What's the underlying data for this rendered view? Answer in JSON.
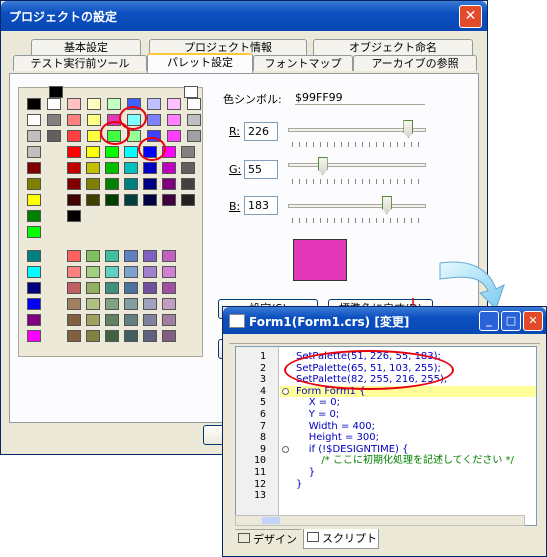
{
  "dialog": {
    "title": "プロジェクトの設定",
    "tabs_row1": [
      "基本設定",
      "プロジェクト情報",
      "オブジェクト命名"
    ],
    "tabs_row2": [
      "テスト実行前ツール",
      "パレット設定",
      "フォントマップ",
      "アーカイブの参照"
    ],
    "selected_tab": "パレット設定",
    "color_symbol_label": "色シンボル:",
    "color_symbol_value": "$99FF99",
    "r_label": "R:",
    "r_value": "226",
    "r_level": 0.886,
    "g_label": "G:",
    "g_value": "55",
    "g_level": 0.216,
    "b_label": "B:",
    "b_value": "183",
    "b_level": 0.718,
    "preview_color": "#e237b7",
    "btn_set": "設定(S)",
    "btn_default": "標準色に戻す(D)"
  },
  "palette": {
    "colors": [
      [
        "#000000",
        "#ffffff",
        "#ffc0c0",
        "#ffffc0",
        "#c0ffc0",
        "#4060ff",
        "#c0c0ff",
        "#ffc0ff",
        "#ffffff"
      ],
      [
        "#ffffff",
        "#808080",
        "#ff8080",
        "#ffff80",
        "#e237b7",
        "#80ffff",
        "#8080ff",
        "#ff80ff",
        "#c0c0c0"
      ],
      [
        "#c0c0c0",
        "#606060",
        "#ff4040",
        "#ffff40",
        "#40ff40",
        "#99ff99",
        "#4040ff",
        "#ff40ff",
        "#a0a0a0"
      ],
      [
        "#c0c0c0",
        "#ff0000",
        "#ffff00",
        "#00ff00",
        "#00ffff",
        "#0000ff",
        "#ff00ff",
        "#808080"
      ],
      [
        "#800000",
        "#c00000",
        "#c0c000",
        "#00c000",
        "#00c0c0",
        "#0000c0",
        "#c000c0",
        "#606060"
      ],
      [
        "#808000",
        "#800000",
        "#808000",
        "#008000",
        "#008080",
        "#000080",
        "#800080",
        "#404040"
      ],
      [
        "#ffff00",
        "#400000",
        "#404000",
        "#004000",
        "#004040",
        "#000040",
        "#400040",
        "#202020"
      ],
      [
        "#008000",
        "#000000"
      ],
      [
        "#00ff00"
      ],
      [
        "#008080",
        "#ff6060",
        "#80c060",
        "#40c0a0",
        "#6080c0",
        "#8060c0",
        "#c060c0"
      ],
      [
        "#00ffff",
        "#ff8080",
        "#a0d080",
        "#60d0c0",
        "#80a0d0",
        "#a080d0",
        "#d080d0"
      ],
      [
        "#000080",
        "#c06060",
        "#90b060",
        "#409080",
        "#5070a0",
        "#7050a0",
        "#a050a0"
      ],
      [
        "#0000ff",
        "#a08060",
        "#b0c080",
        "#80a080",
        "#80a0a0",
        "#a0a0c0",
        "#c0a0c0"
      ],
      [
        "#800080",
        "#806040",
        "#a0a060",
        "#608060",
        "#608080",
        "#8080a0",
        "#a080a0"
      ],
      [
        "#ff00ff",
        "#806040",
        "#808040",
        "#406040",
        "#406060",
        "#606080",
        "#806080"
      ]
    ]
  },
  "editor": {
    "title": "Form1(Form1.crs) [変更]",
    "line_numbers": [
      "1",
      "2",
      "3",
      "4",
      "5",
      "6",
      "7",
      "8",
      "9",
      "10",
      "11",
      "12",
      "13"
    ],
    "lines": [
      "SetPalette(51, 226, 55, 183);",
      "SetPalette(65, 51, 103, 255);",
      "SetPalette(82, 255, 216, 255);",
      "Form Form1 {",
      "    X = 0;",
      "    Y = 0;",
      "    Width = 400;",
      "    Height = 300;",
      "    if (!$DESIGNTIME) {",
      "        /* ここに初期化処理を記述してください */",
      "    }",
      "}",
      ""
    ],
    "tab_design": "デザイン",
    "tab_script": "スクリプト"
  },
  "colors": {
    "titlebar": "#0b4fc0",
    "annotation": "#e8000d",
    "highlight": "#ffff99"
  }
}
